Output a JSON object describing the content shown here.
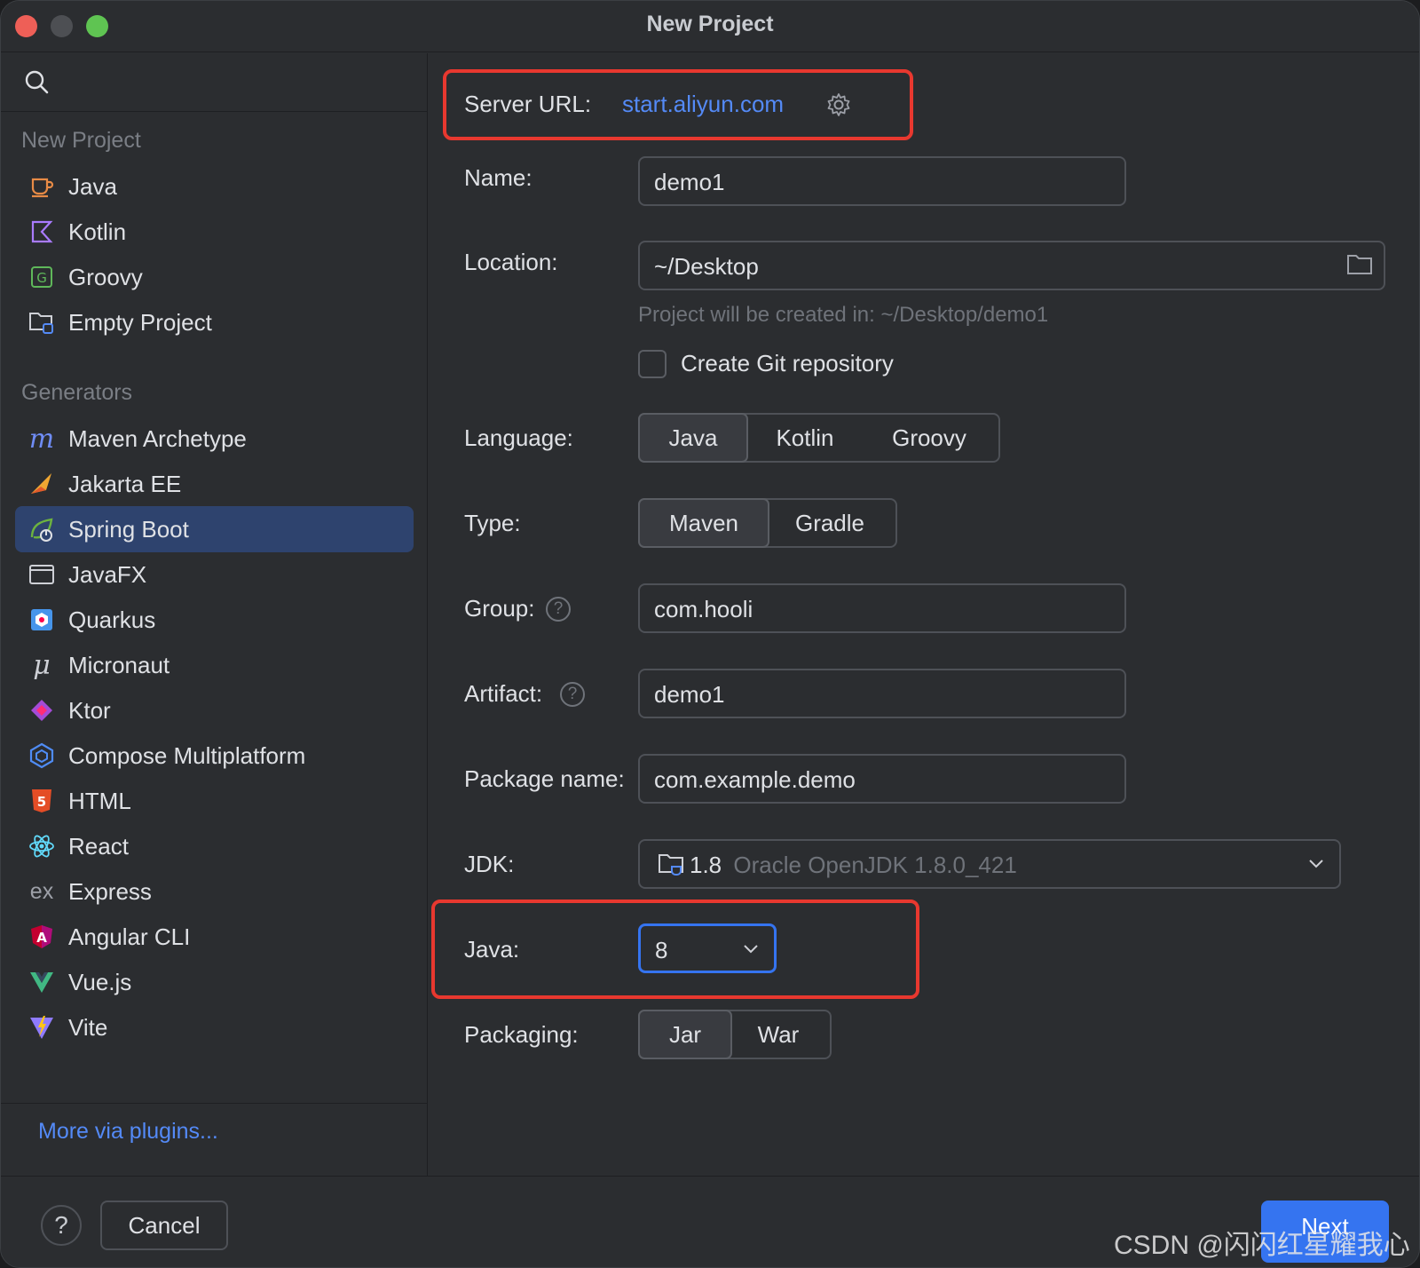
{
  "window": {
    "title": "New Project"
  },
  "sidebar": {
    "new_project_heading": "New Project",
    "new_project_items": [
      {
        "label": "Java",
        "icon": "java-cup-icon"
      },
      {
        "label": "Kotlin",
        "icon": "kotlin-icon"
      },
      {
        "label": "Groovy",
        "icon": "groovy-icon"
      },
      {
        "label": "Empty Project",
        "icon": "empty-project-icon"
      }
    ],
    "generators_heading": "Generators",
    "generator_items": [
      {
        "label": "Maven Archetype",
        "icon": "maven-icon"
      },
      {
        "label": "Jakarta EE",
        "icon": "jakarta-icon"
      },
      {
        "label": "Spring Boot",
        "icon": "spring-boot-icon",
        "selected": true
      },
      {
        "label": "JavaFX",
        "icon": "javafx-icon"
      },
      {
        "label": "Quarkus",
        "icon": "quarkus-icon"
      },
      {
        "label": "Micronaut",
        "icon": "micronaut-icon"
      },
      {
        "label": "Ktor",
        "icon": "ktor-icon"
      },
      {
        "label": "Compose Multiplatform",
        "icon": "compose-icon"
      },
      {
        "label": "HTML",
        "icon": "html5-icon"
      },
      {
        "label": "React",
        "icon": "react-icon"
      },
      {
        "label": "Express",
        "icon": "express-icon"
      },
      {
        "label": "Angular CLI",
        "icon": "angular-icon"
      },
      {
        "label": "Vue.js",
        "icon": "vue-icon"
      },
      {
        "label": "Vite",
        "icon": "vite-icon"
      }
    ],
    "more_link": "More via plugins..."
  },
  "form": {
    "server_url_label": "Server URL:",
    "server_url_value": "start.aliyun.com",
    "name_label": "Name:",
    "name_value": "demo1",
    "location_label": "Location:",
    "location_value": "~/Desktop",
    "location_hint": "Project will be created in: ~/Desktop/demo1",
    "git_checkbox_label": "Create Git repository",
    "language_label": "Language:",
    "language_options": [
      "Java",
      "Kotlin",
      "Groovy"
    ],
    "language_selected": "Java",
    "type_label": "Type:",
    "type_options": [
      "Maven",
      "Gradle"
    ],
    "type_selected": "Maven",
    "group_label": "Group:",
    "group_value": "com.hooli",
    "artifact_label": "Artifact:",
    "artifact_value": "demo1",
    "package_label": "Package name:",
    "package_value": "com.example.demo",
    "jdk_label": "JDK:",
    "jdk_version": "1.8",
    "jdk_name": "Oracle OpenJDK 1.8.0_421",
    "java_label": "Java:",
    "java_value": "8",
    "packaging_label": "Packaging:",
    "packaging_options": [
      "Jar",
      "War"
    ],
    "packaging_selected": "Jar"
  },
  "footer": {
    "help": "?",
    "cancel": "Cancel",
    "next": "Next",
    "watermark": "CSDN @闪闪红星耀我心"
  },
  "colors": {
    "accent": "#3574f0",
    "link": "#548af7",
    "selection": "#2e436e",
    "highlight_box": "#e8382f"
  }
}
